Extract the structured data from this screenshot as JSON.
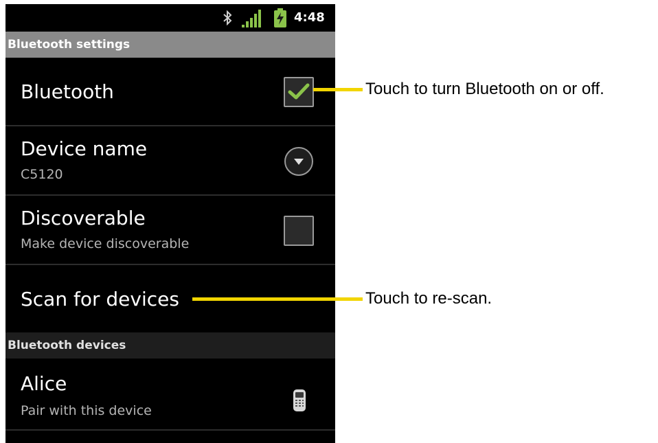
{
  "status_bar": {
    "time": "4:48",
    "icons": [
      "bluetooth-icon",
      "signal-icon",
      "battery-charging-icon"
    ],
    "accent": "#8bc34a"
  },
  "header": {
    "title": "Bluetooth settings"
  },
  "settings": {
    "bluetooth": {
      "title": "Bluetooth",
      "checked": true
    },
    "device_name": {
      "title": "Device name",
      "value": "C5120"
    },
    "discoverable": {
      "title": "Discoverable",
      "subtitle": "Make device discoverable",
      "checked": false
    },
    "scan": {
      "title": "Scan for devices"
    }
  },
  "devices_section": {
    "title": "Bluetooth devices"
  },
  "devices": [
    {
      "name": "Alice",
      "subtitle": "Pair with this device",
      "icon": "phone-icon"
    }
  ],
  "annotations": [
    {
      "text": "Touch to turn Bluetooth on or off.",
      "color": "#f2d500"
    },
    {
      "text": "Touch to re-scan.",
      "color": "#f2d500"
    }
  ]
}
